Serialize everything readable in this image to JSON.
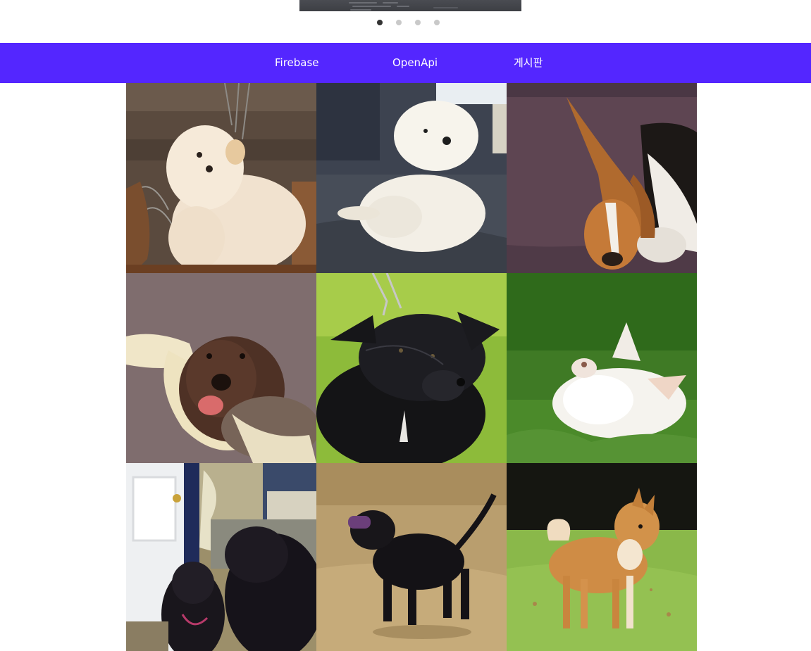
{
  "carousel": {
    "slide_count": 4,
    "active_index": 0,
    "slide_image": "dark-code-screenshot"
  },
  "nav": {
    "items": [
      {
        "label": "Firebase"
      },
      {
        "label": "OpenApi"
      },
      {
        "label": "게시판"
      }
    ],
    "background_color": "#5426ff",
    "text_color": "#ffffff"
  },
  "gallery": {
    "images": [
      {
        "subject": "cream-chow-chow-puppy"
      },
      {
        "subject": "white-fluffy-puppy-on-couch"
      },
      {
        "subject": "beagle-sleeping-on-sofa"
      },
      {
        "subject": "brown-labradoodle-with-toy"
      },
      {
        "subject": "black-staffordshire-terrier-on-grass"
      },
      {
        "subject": "white-chihuahua-rolling-in-grass"
      },
      {
        "subject": "two-black-schnauzers-indoors"
      },
      {
        "subject": "black-staffordshire-with-toy-in-field"
      },
      {
        "subject": "shiba-inu-on-lawn"
      }
    ]
  }
}
